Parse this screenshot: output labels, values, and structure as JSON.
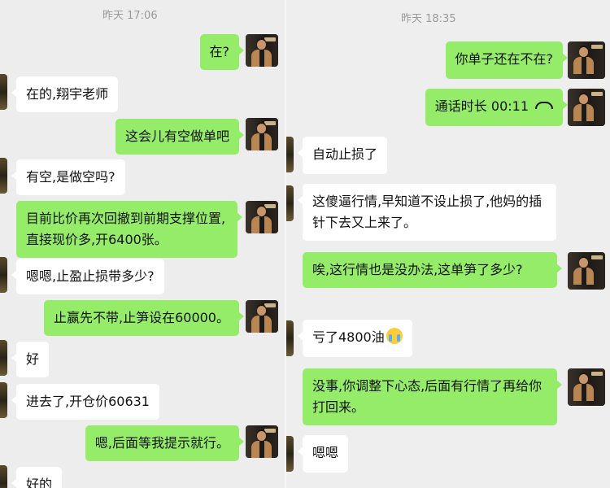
{
  "left": {
    "timestamp": "昨天 17:06",
    "messages": [
      {
        "from": "me",
        "text": "在?"
      },
      {
        "from": "them",
        "text": "在的,翔宇老师"
      },
      {
        "from": "me",
        "text": "这会儿有空做单吧"
      },
      {
        "from": "them",
        "text": "有空,是做空吗?"
      },
      {
        "from": "me",
        "text": "目前比价再次回撤到前期支撑位置,直接现价多,开6400张。"
      },
      {
        "from": "them",
        "text": "嗯嗯,止盈止损带多少?"
      },
      {
        "from": "me",
        "text": "止赢先不带,止笋设在60000。"
      },
      {
        "from": "them",
        "text": "好"
      },
      {
        "from": "them",
        "text": "进去了,开仓价60631"
      },
      {
        "from": "me",
        "text": "嗯,后面等我提示就行。"
      },
      {
        "from": "them",
        "text": "好的"
      }
    ]
  },
  "right": {
    "timestamp": "昨天 18:35",
    "messages": [
      {
        "from": "me",
        "text": "你单子还在不在?"
      },
      {
        "from": "me",
        "text": "通话时长 00:11",
        "icon": "phone-hangup-icon"
      },
      {
        "from": "them",
        "text": "自动止损了"
      },
      {
        "from": "them",
        "text": "这傻逼行情,早知道不设止损了,他妈的插针下去又上来了。"
      },
      {
        "from": "me",
        "text": "唉,这行情也是没办法,这单笋了多少?"
      },
      {
        "from": "them",
        "text": "亏了4800油",
        "icon": "crying-face-emoji"
      },
      {
        "from": "me",
        "text": "没事,你调整下心态,后面有行情了再给你打回来。"
      },
      {
        "from": "them",
        "text": "嗯嗯"
      }
    ]
  }
}
